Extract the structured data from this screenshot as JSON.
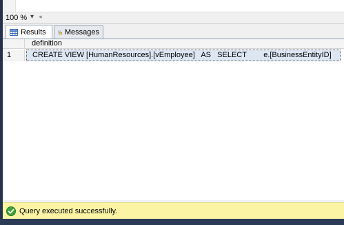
{
  "toolbar": {
    "zoom_value": "100 %",
    "zoom_arrow": "▾",
    "scroll_arrow": "◂"
  },
  "tabs": [
    {
      "label": "Results",
      "icon": "results-grid-icon",
      "active": true
    },
    {
      "label": "Messages",
      "icon": "messages-icon",
      "active": false
    }
  ],
  "grid": {
    "columns": [
      "definition"
    ],
    "rows": [
      {
        "num": "1",
        "definition": "CREATE VIEW [HumanResources].[vEmployee]   AS   SELECT        e.[BusinessEntityID]      ,p.[..."
      }
    ]
  },
  "status": {
    "text": "Query executed successfully.",
    "icon": "success-check-icon",
    "color": "#fbf4a4"
  }
}
